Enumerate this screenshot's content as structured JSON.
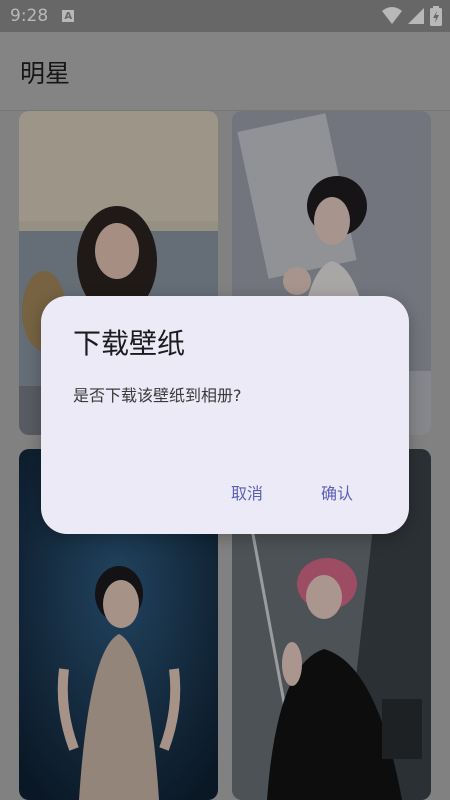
{
  "status_bar": {
    "time": "9:28",
    "a_icon_label": "A",
    "icons": [
      "wifi-icon",
      "signal-icon",
      "battery-icon"
    ]
  },
  "app_bar": {
    "title": "明星"
  },
  "wallpapers": [
    {
      "name": "wallpaper-1"
    },
    {
      "name": "wallpaper-2"
    },
    {
      "name": "wallpaper-3"
    },
    {
      "name": "wallpaper-4"
    }
  ],
  "dialog": {
    "title": "下载壁纸",
    "message": "是否下载该壁纸到相册?",
    "cancel_label": "取消",
    "confirm_label": "确认"
  },
  "colors": {
    "accent": "#5a5fb8",
    "dialog_bg": "#edeaf8"
  }
}
